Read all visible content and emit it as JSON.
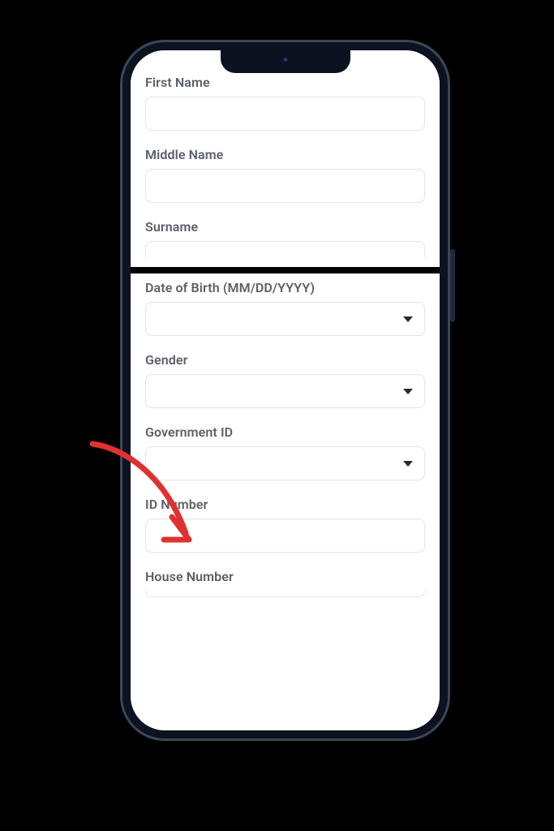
{
  "annotation": {
    "arrow_color": "#e03131",
    "points_to": "government-id-label"
  },
  "form": {
    "section1": {
      "fields": [
        {
          "label": "First Name",
          "type": "text",
          "name": "first-name"
        },
        {
          "label": "Middle Name",
          "type": "text",
          "name": "middle-name"
        },
        {
          "label": "Surname",
          "type": "text",
          "name": "surname"
        }
      ]
    },
    "section2": {
      "fields": [
        {
          "label": "Date of Birth (MM/DD/YYYY)",
          "type": "select",
          "name": "date-of-birth"
        },
        {
          "label": "Gender",
          "type": "select",
          "name": "gender"
        },
        {
          "label": "Government ID",
          "type": "select",
          "name": "government-id"
        },
        {
          "label": "ID Number",
          "type": "text",
          "name": "id-number"
        },
        {
          "label": "House Number",
          "type": "text",
          "name": "house-number"
        }
      ]
    }
  }
}
